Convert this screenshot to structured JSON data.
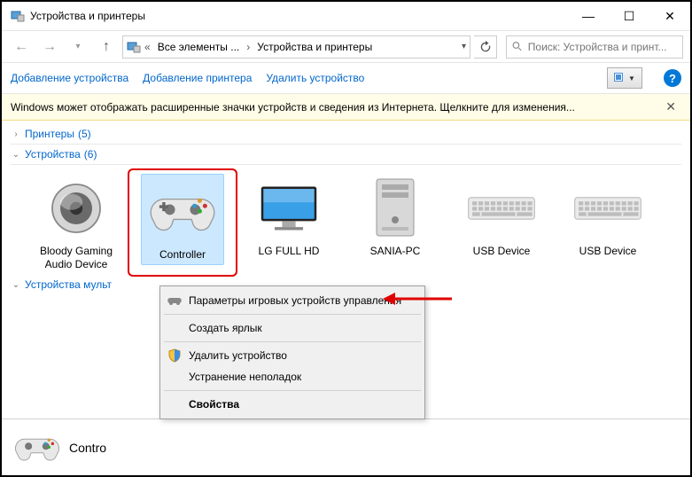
{
  "window": {
    "title": "Устройства и принтеры"
  },
  "breadcrumbs": {
    "seg1": "Все элементы ...",
    "seg2": "Устройства и принтеры"
  },
  "search": {
    "placeholder": "Поиск: Устройства и принт..."
  },
  "toolbar": {
    "add_device": "Добавление устройства",
    "add_printer": "Добавление принтера",
    "remove_device": "Удалить устройство"
  },
  "infobar": {
    "message": "Windows может отображать расширенные значки устройств и сведения из Интернета.  Щелкните для изменения..."
  },
  "groups": {
    "printers": {
      "label": "Принтеры",
      "count": "(5)"
    },
    "devices": {
      "label": "Устройства",
      "count": "(6)"
    },
    "multimedia": {
      "label": "Устройства мульт"
    }
  },
  "devices": [
    {
      "name": "Bloody Gaming Audio Device"
    },
    {
      "name": "Controller"
    },
    {
      "name": "LG FULL HD"
    },
    {
      "name": "SANIA-PC"
    },
    {
      "name": "USB Device"
    },
    {
      "name": "USB Device"
    }
  ],
  "context_menu": {
    "game_settings": "Параметры игровых устройств управления",
    "create_shortcut": "Создать ярлык",
    "remove": "Удалить устройство",
    "troubleshoot": "Устранение неполадок",
    "properties": "Свойства"
  },
  "details": {
    "name": "Contro"
  }
}
